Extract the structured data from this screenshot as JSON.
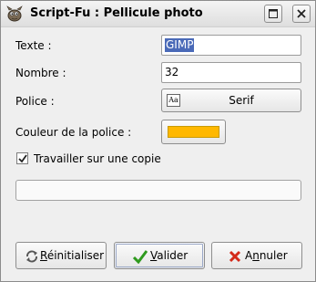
{
  "window": {
    "title": "Script-Fu : Pellicule photo",
    "controls": {
      "maximize_icon": "maximize-icon",
      "close_icon": "close-icon"
    }
  },
  "form": {
    "text_label": "Texte :",
    "text_value": "GIMP",
    "number_label": "Nombre :",
    "number_value": "32",
    "font_label": "Police :",
    "font_value": "Serif",
    "font_icon_text": "Aa",
    "color_label": "Couleur de la police :",
    "color_value": "#ffb800",
    "copy_label": "Travailler sur une copie",
    "copy_checked": true,
    "progress": 0
  },
  "actions": {
    "reset": {
      "pre": "",
      "key": "R",
      "post": "éinitialiser"
    },
    "validate": {
      "pre": "",
      "key": "V",
      "post": "alider"
    },
    "cancel": {
      "pre": "A",
      "key": "n",
      "post": "nuler"
    }
  },
  "colors": {
    "selection": "#4a6ab8",
    "accent": "#ffb800"
  }
}
